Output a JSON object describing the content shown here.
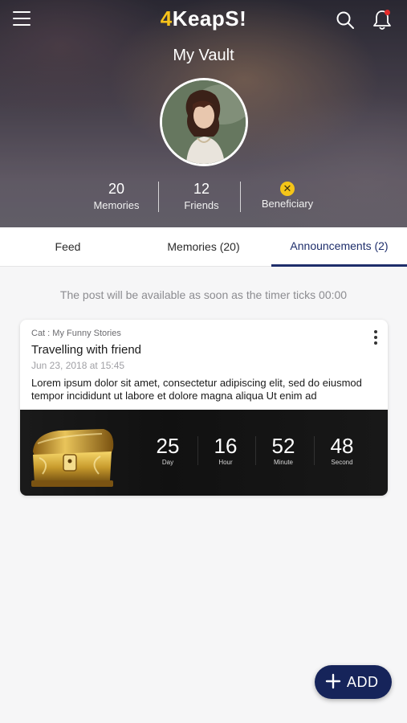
{
  "header": {
    "logo_prefix": "4",
    "logo_main": "KeapS!",
    "title": "My Vault",
    "stats": [
      {
        "value": "20",
        "label": "Memories"
      },
      {
        "value": "12",
        "label": "Friends"
      },
      {
        "label": "Beneficiary",
        "icon": "close-circle-icon"
      }
    ],
    "has_notification": true,
    "colors": {
      "accent": "#f6c21a",
      "notification_dot": "#e52b2b"
    }
  },
  "tabs": [
    {
      "label": "Feed",
      "active": false
    },
    {
      "label": "Memories (20)",
      "active": false
    },
    {
      "label": "Announcements (2)",
      "active": true
    }
  ],
  "notice": "The post will be available as soon as the timer ticks 00:00",
  "post": {
    "category": "Cat : My Funny Stories",
    "title": "Travelling with friend",
    "date": "Jun 23, 2018 at 15:45",
    "body": "Lorem ipsum dolor sit amet, consectetur adipiscing elit, sed do eiusmod tempor incididunt ut labore et dolore magna aliqua Ut enim ad",
    "image": "treasure-chest",
    "countdown": [
      {
        "value": "25",
        "label": "Day"
      },
      {
        "value": "16",
        "label": "Hour"
      },
      {
        "value": "52",
        "label": "Minute"
      },
      {
        "value": "48",
        "label": "Second"
      }
    ]
  },
  "fab": {
    "label": "ADD",
    "icon": "plus-icon",
    "color": "#16245a"
  },
  "theme": {
    "tab_active": "#1e2e6b"
  }
}
